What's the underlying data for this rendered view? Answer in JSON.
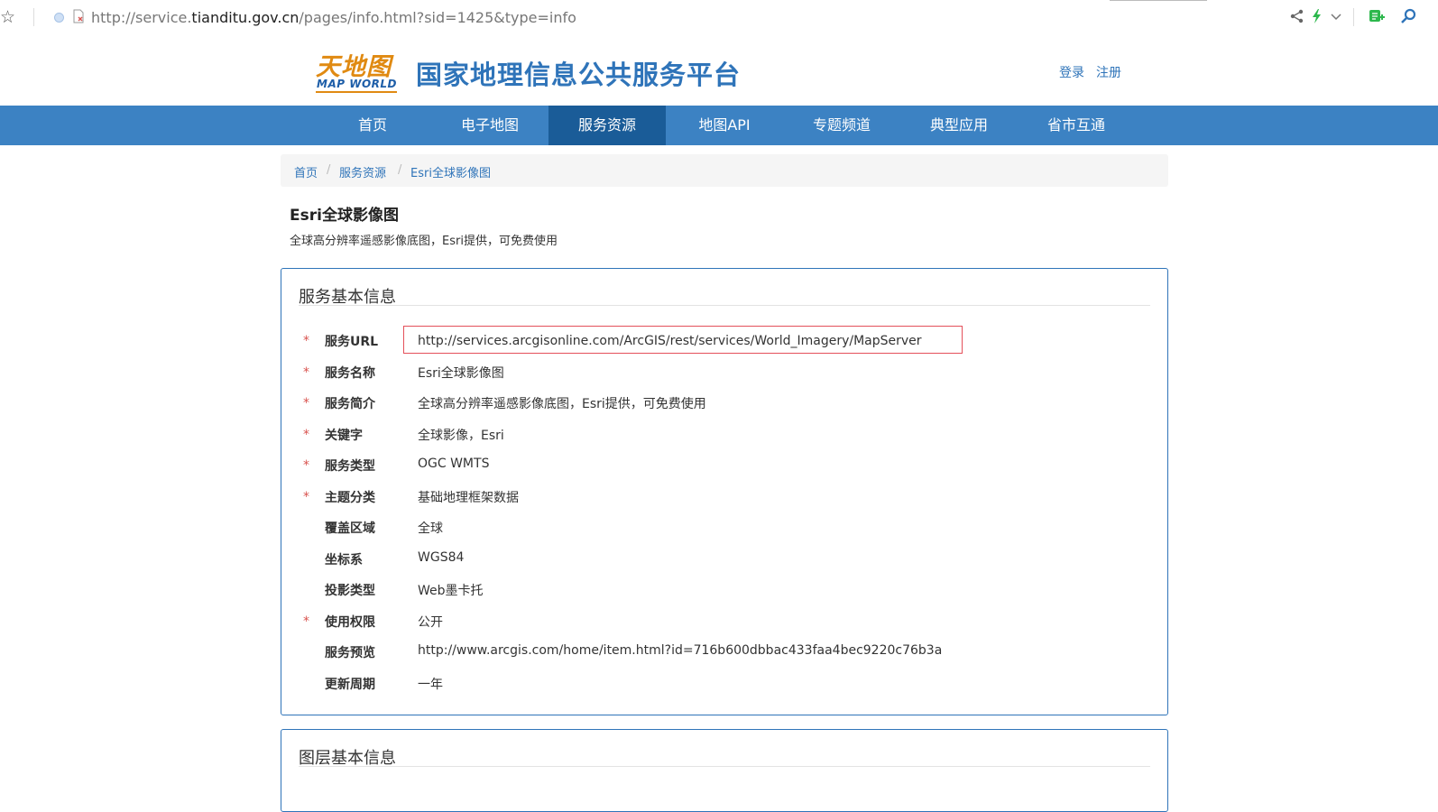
{
  "browser": {
    "url_prefix": "http://service.",
    "url_host": "tianditu.gov.cn",
    "url_path": "/pages/info.html?sid=1425&type=info",
    "icons": [
      "star-icon",
      "share-icon",
      "lightning-icon",
      "chevron-down-icon",
      "extension-icon",
      "search-icon"
    ]
  },
  "header": {
    "logo_cn": "天地图",
    "logo_en": "MAP WORLD",
    "title": "国家地理信息公共服务平台",
    "login": "登录",
    "register": "注册"
  },
  "nav": {
    "items": [
      "首页",
      "电子地图",
      "服务资源",
      "地图API",
      "专题频道",
      "典型应用",
      "省市互通"
    ],
    "active_index": 2
  },
  "breadcrumb": [
    "首页",
    "服务资源",
    "Esri全球影像图"
  ],
  "breadcrumb_sep": "/",
  "page": {
    "title": "Esri全球影像图",
    "subtitle": "全球高分辨率遥感影像底图，Esri提供，可免费使用"
  },
  "service_panel": {
    "title": "服务基本信息",
    "required_mark": "*",
    "rows": [
      {
        "label": "服务URL",
        "value": "http://services.arcgisonline.com/ArcGIS/rest/services/World_Imagery/MapServer",
        "required": true,
        "highlighted": true
      },
      {
        "label": "服务名称",
        "value": "Esri全球影像图",
        "required": true
      },
      {
        "label": "服务简介",
        "value": "全球高分辨率遥感影像底图，Esri提供，可免费使用",
        "required": true
      },
      {
        "label": "关键字",
        "value": "全球影像，Esri",
        "required": true
      },
      {
        "label": "服务类型",
        "value": "OGC WMTS",
        "required": true
      },
      {
        "label": "主题分类",
        "value": "基础地理框架数据",
        "required": true
      },
      {
        "label": "覆盖区域",
        "value": "全球",
        "required": false
      },
      {
        "label": "坐标系",
        "value": "WGS84",
        "required": false
      },
      {
        "label": "投影类型",
        "value": "Web墨卡托",
        "required": false
      },
      {
        "label": "使用权限",
        "value": "公开",
        "required": true
      },
      {
        "label": "服务预览",
        "value": "http://www.arcgis.com/home/item.html?id=716b600dbbac433faa4bec9220c76b3a",
        "required": false
      },
      {
        "label": "更新周期",
        "value": "一年",
        "required": false
      }
    ]
  },
  "layer_panel": {
    "title": "图层基本信息"
  },
  "colors": {
    "nav_bg": "#3c82c3",
    "nav_active": "#1a5c98",
    "brand_blue": "#2f74b9",
    "logo_orange": "#e08a12",
    "required_red": "#d9534f",
    "highlight_border": "#e4505a"
  }
}
